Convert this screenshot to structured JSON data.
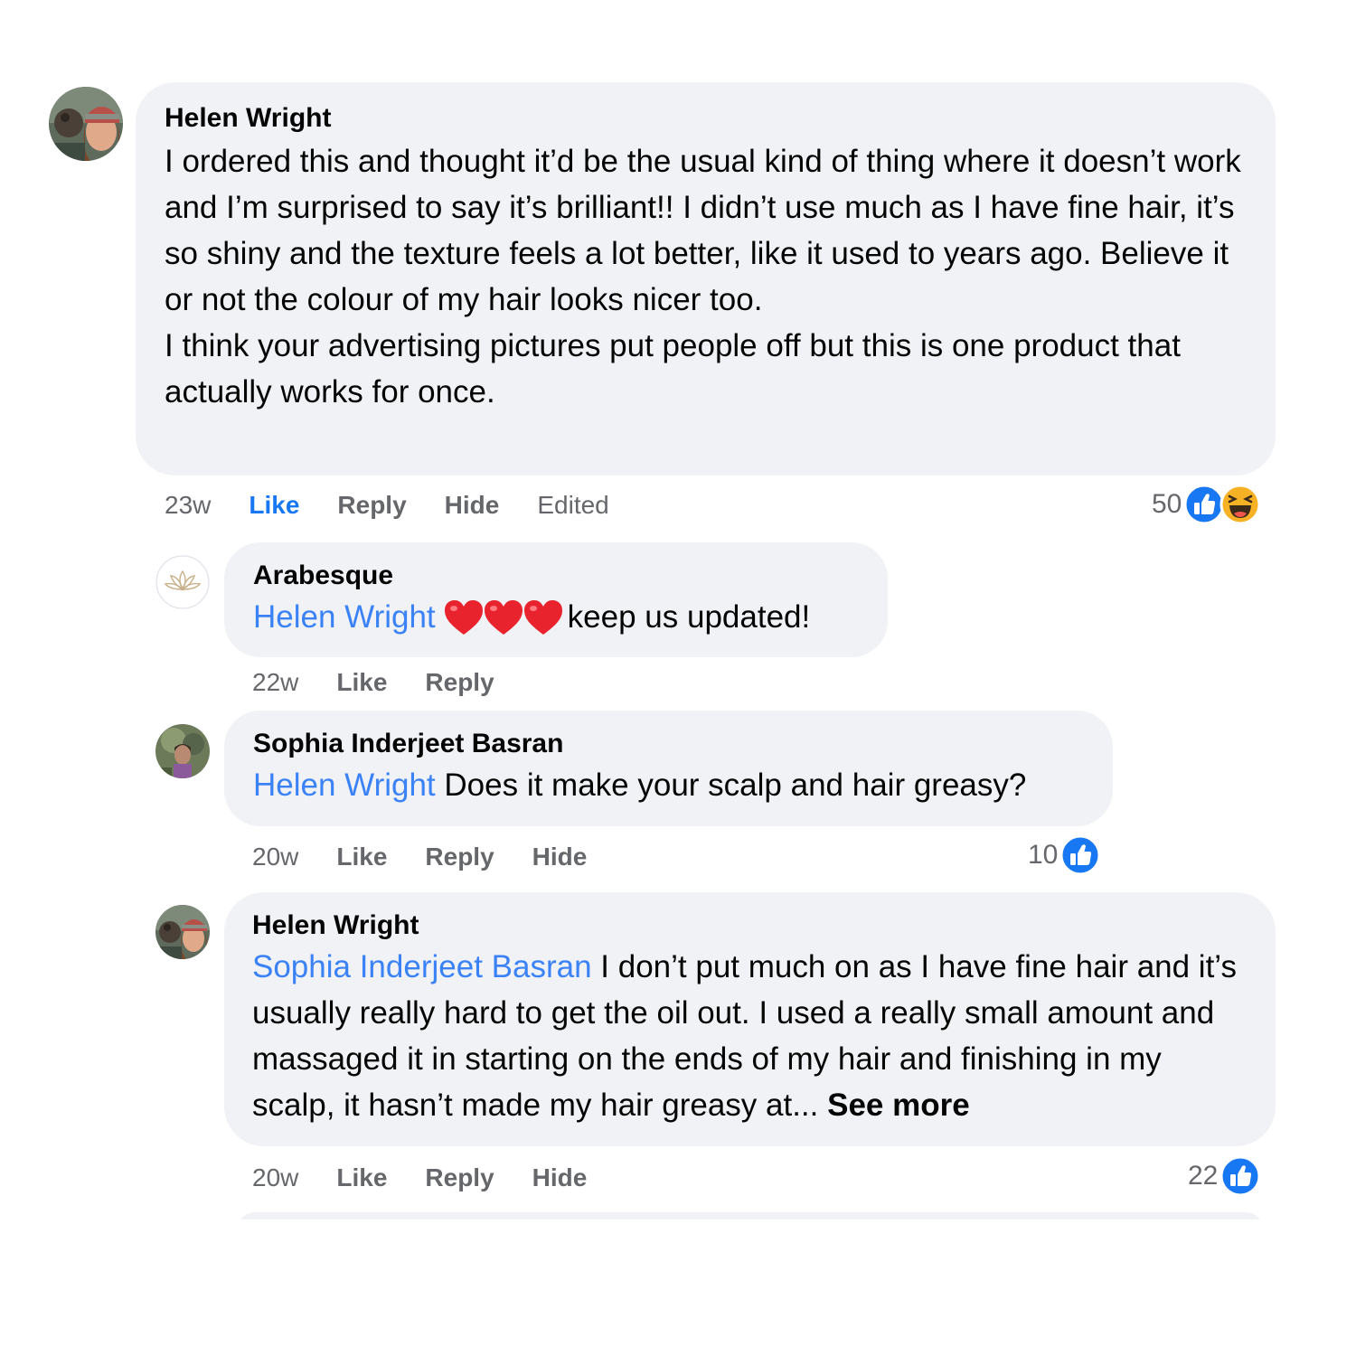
{
  "comments": [
    {
      "author": "Helen Wright",
      "paragraphs": [
        "I ordered this and thought it’d be the usual kind of thing where it doesn’t work and I’m surprised to say it’s brilliant!! I didn’t use much as I have fine hair, it’s so shiny and the texture feels a lot better, like it used to years ago. Believe it or not the colour of my hair looks nicer too.",
        "I think your advertising pictures put people off but this is one product that actually works for once."
      ],
      "time": "23w",
      "like_label": "Like",
      "reply_label": "Reply",
      "hide_label": "Hide",
      "edited_label": "Edited",
      "reaction_count": "50",
      "reactions": [
        "like-icon",
        "haha-icon"
      ],
      "liked": true
    },
    {
      "author": "Arabesque",
      "mention": "Helen Wright",
      "emoji": [
        "red-heart",
        "red-heart",
        "red-heart"
      ],
      "text": "keep us updated!",
      "time": "22w",
      "like_label": "Like",
      "reply_label": "Reply"
    },
    {
      "author": "Sophia Inderjeet Basran",
      "mention": "Helen Wright",
      "text": "Does it make your scalp and hair greasy?",
      "time": "20w",
      "like_label": "Like",
      "reply_label": "Reply",
      "hide_label": "Hide",
      "reaction_count": "10",
      "reactions": [
        "like-icon"
      ]
    },
    {
      "author": "Helen Wright",
      "mention": "Sophia Inderjeet Basran",
      "text": "I don’t put much on as I have fine hair and it’s usually really hard to get the oil out. I used a really small amount and massaged it in starting on the ends of my hair and finishing in my scalp, it hasn’t made my hair greasy at...",
      "see_more": "See more",
      "time": "20w",
      "like_label": "Like",
      "reply_label": "Reply",
      "hide_label": "Hide",
      "reaction_count": "22",
      "reactions": [
        "like-icon"
      ]
    }
  ],
  "colors": {
    "bubble": "#f0f2f5",
    "mention": "#3b82f6",
    "liked": "#1877f2",
    "meta": "#65676b",
    "like_badge": "#1877f2",
    "haha_badge": "#f7b125"
  }
}
